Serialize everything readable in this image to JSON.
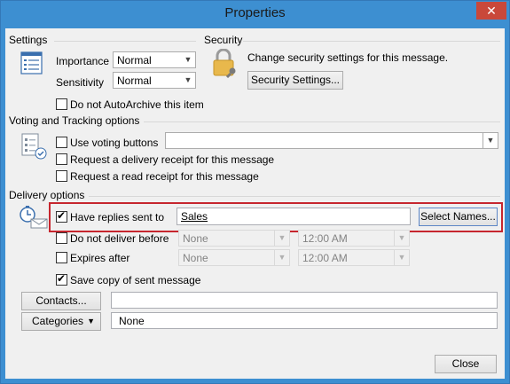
{
  "window": {
    "title": "Properties",
    "close_glyph": "✕"
  },
  "settings": {
    "header": "Settings",
    "importance_label": "Importance",
    "importance_value": "Normal",
    "sensitivity_label": "Sensitivity",
    "sensitivity_value": "Normal",
    "autoarchive_label": "Do not AutoArchive this item"
  },
  "security": {
    "header": "Security",
    "description": "Change security settings for this message.",
    "button_label": "Security Settings..."
  },
  "voting": {
    "header": "Voting and Tracking options",
    "use_voting_label": "Use voting buttons",
    "voting_value": "",
    "delivery_receipt_label": "Request a delivery receipt for this message",
    "read_receipt_label": "Request a read receipt for this message"
  },
  "delivery": {
    "header": "Delivery options",
    "replies_label": "Have replies sent to",
    "replies_value": "Sales",
    "select_names_label": "Select Names...",
    "do_not_deliver_label": "Do not deliver before",
    "do_not_deliver_date": "None",
    "do_not_deliver_time": "12:00 AM",
    "expires_label": "Expires after",
    "expires_date": "None",
    "expires_time": "12:00 AM",
    "save_copy_label": "Save copy of sent message"
  },
  "contacts": {
    "button_label": "Contacts...",
    "value": ""
  },
  "categories": {
    "button_label": "Categories",
    "value": "None"
  },
  "footer": {
    "close_label": "Close"
  },
  "colors": {
    "title_bar": "#3d8fd1",
    "close_button": "#c9483a",
    "highlight_box": "#c6262e"
  }
}
